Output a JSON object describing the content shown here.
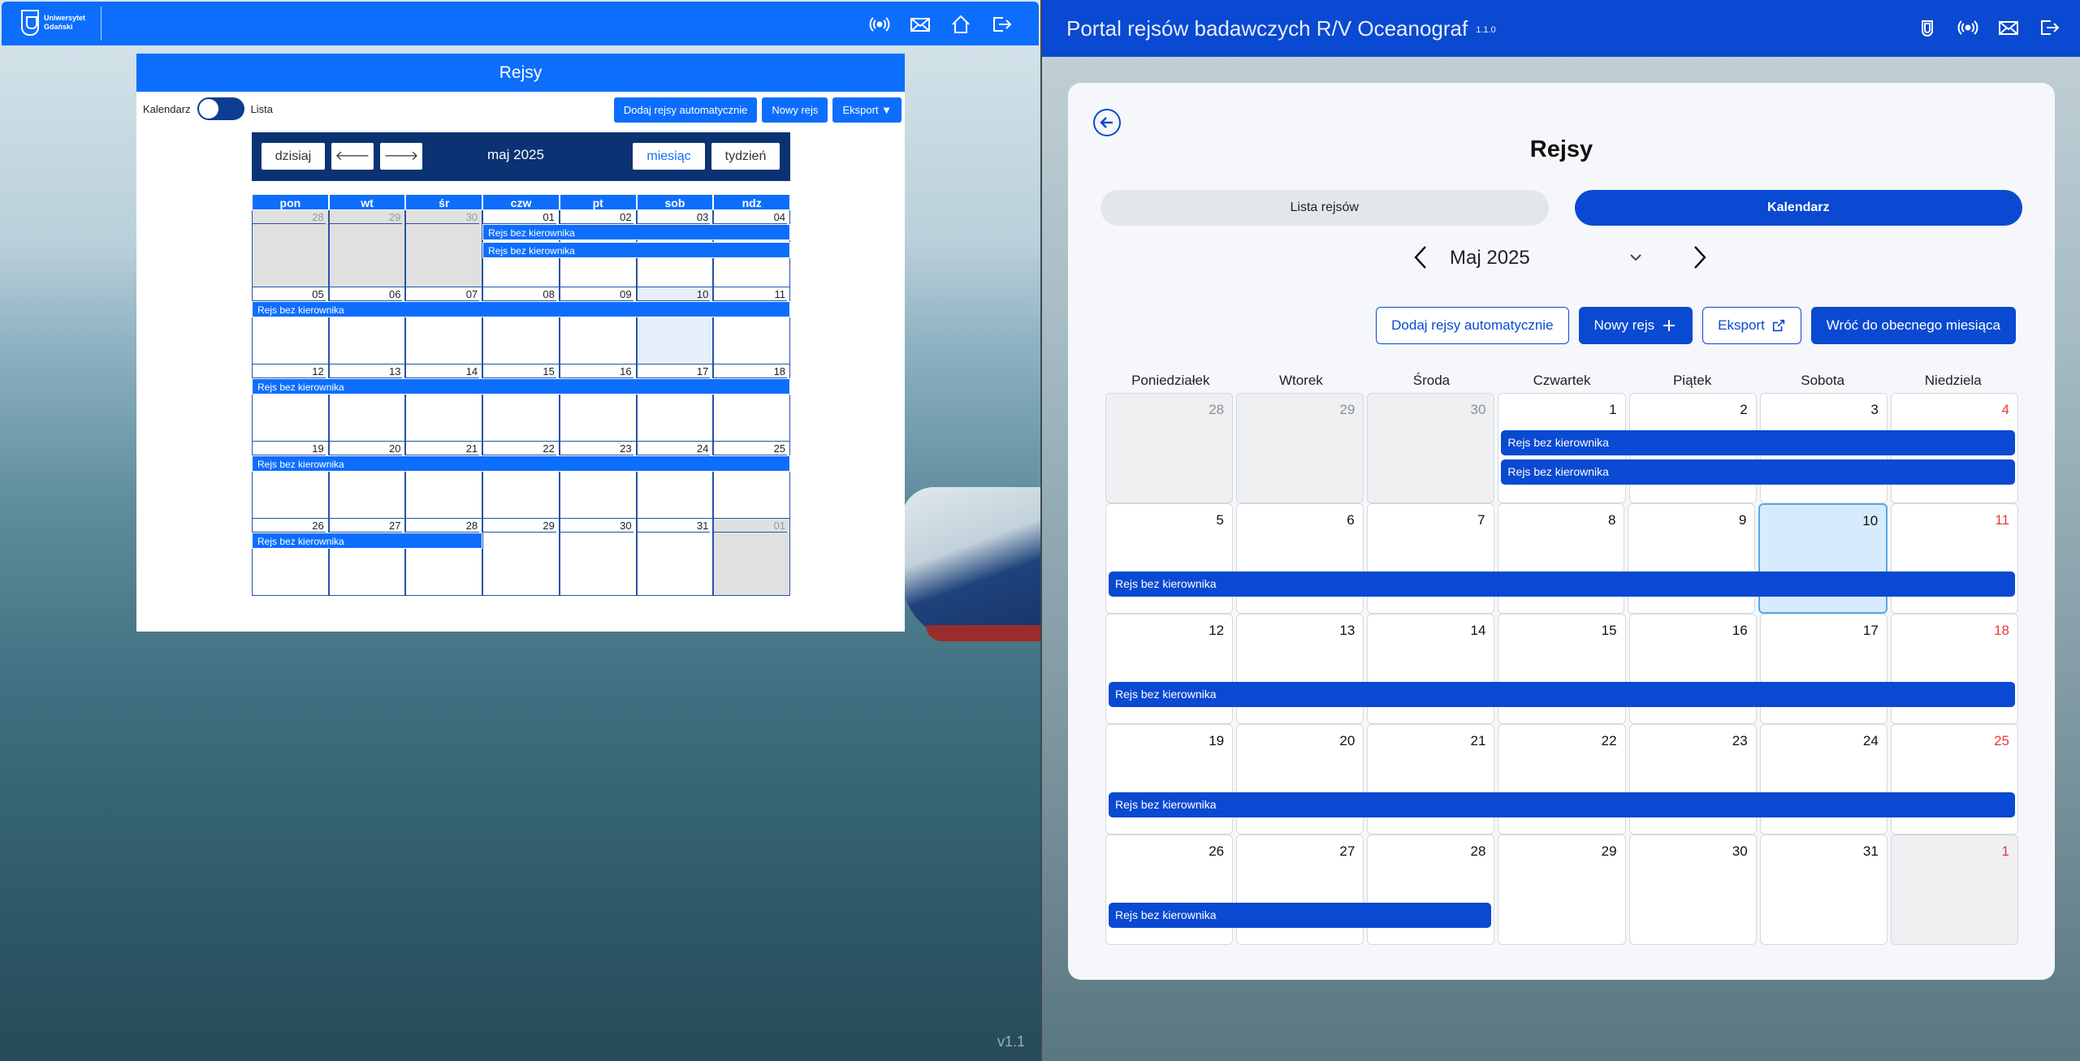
{
  "left": {
    "logo_text": [
      "Uniwersytet",
      "Gdański"
    ],
    "header_title": "Rejsy",
    "view_toggle": {
      "left_label": "Kalendarz",
      "right_label": "Lista"
    },
    "buttons": {
      "auto": "Dodaj rejsy automatycznie",
      "new": "Nowy rejs",
      "export": "Eksport ▼"
    },
    "nav": {
      "today": "dzisiaj",
      "prev": "🡐",
      "next": "🡒",
      "month_label": "maj 2025",
      "month": "miesiąc",
      "week": "tydzień"
    },
    "dow": [
      "pon",
      "wt",
      "śr",
      "czw",
      "pt",
      "sob",
      "ndz"
    ],
    "weeks": [
      [
        "28",
        "29",
        "30",
        "01",
        "02",
        "03",
        "04"
      ],
      [
        "05",
        "06",
        "07",
        "08",
        "09",
        "10",
        "11"
      ],
      [
        "12",
        "13",
        "14",
        "15",
        "16",
        "17",
        "18"
      ],
      [
        "19",
        "20",
        "21",
        "22",
        "23",
        "24",
        "25"
      ],
      [
        "26",
        "27",
        "28",
        "29",
        "30",
        "31",
        "01"
      ]
    ],
    "event_label": "Rejs bez kierownika",
    "version": "v1.1"
  },
  "right": {
    "app_title": "Portal rejsów badawczych R/V Oceanograf",
    "app_version": "1.1.0",
    "page_title": "Rejsy",
    "tabs": [
      "Lista rejsów",
      "Kalendarz"
    ],
    "month_label": "Maj 2025",
    "buttons": {
      "auto": "Dodaj rejsy automatycznie",
      "new": "Nowy rejs",
      "export": "Eksport",
      "back_to_current": "Wróć do obecnego miesiąca"
    },
    "dow": [
      "Poniedziałek",
      "Wtorek",
      "Środa",
      "Czwartek",
      "Piątek",
      "Sobota",
      "Niedziela"
    ],
    "weeks": [
      [
        "28",
        "29",
        "30",
        "1",
        "2",
        "3",
        "4"
      ],
      [
        "5",
        "6",
        "7",
        "8",
        "9",
        "10",
        "11"
      ],
      [
        "12",
        "13",
        "14",
        "15",
        "16",
        "17",
        "18"
      ],
      [
        "19",
        "20",
        "21",
        "22",
        "23",
        "24",
        "25"
      ],
      [
        "26",
        "27",
        "28",
        "29",
        "30",
        "31",
        "1"
      ]
    ],
    "event_label": "Rejs bez kierownika"
  },
  "colors": {
    "left_primary": "#0d6efd",
    "left_dark": "#0b3273",
    "right_primary": "#0a49d1",
    "sunday": "#e53935",
    "today_bg": "#d6ebfd"
  }
}
